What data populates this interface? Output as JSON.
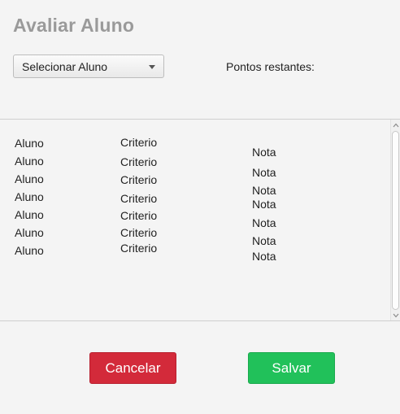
{
  "header": {
    "title": "Avaliar Aluno"
  },
  "controls": {
    "select_aluno_value": "Selecionar Aluno",
    "points_label": "Pontos restantes:"
  },
  "table": {
    "rows": [
      {
        "aluno": "Aluno",
        "criterio": "Criterio",
        "nota": "Nota"
      },
      {
        "aluno": "Aluno",
        "criterio": "Criterio",
        "nota": "Nota"
      },
      {
        "aluno": "Aluno",
        "criterio": "Criterio",
        "nota": "Nota"
      },
      {
        "aluno": "Aluno",
        "criterio": "Criterio",
        "nota": "Nota"
      },
      {
        "aluno": "Aluno",
        "criterio": "Criterio",
        "nota": "Nota"
      },
      {
        "aluno": "Aluno",
        "criterio": "Criterio",
        "nota": "Nota"
      },
      {
        "aluno": "Aluno",
        "criterio": "Criterio",
        "nota": "Nota"
      }
    ]
  },
  "actions": {
    "cancel_label": "Cancelar",
    "save_label": "Salvar"
  },
  "colors": {
    "cancel": "#d32a3a",
    "save": "#21c15a",
    "title": "#9a9a9a"
  },
  "icons": {
    "dropdown": "chevron-down-icon",
    "scroll_up": "scroll-up-icon",
    "scroll_down": "scroll-down-icon"
  }
}
